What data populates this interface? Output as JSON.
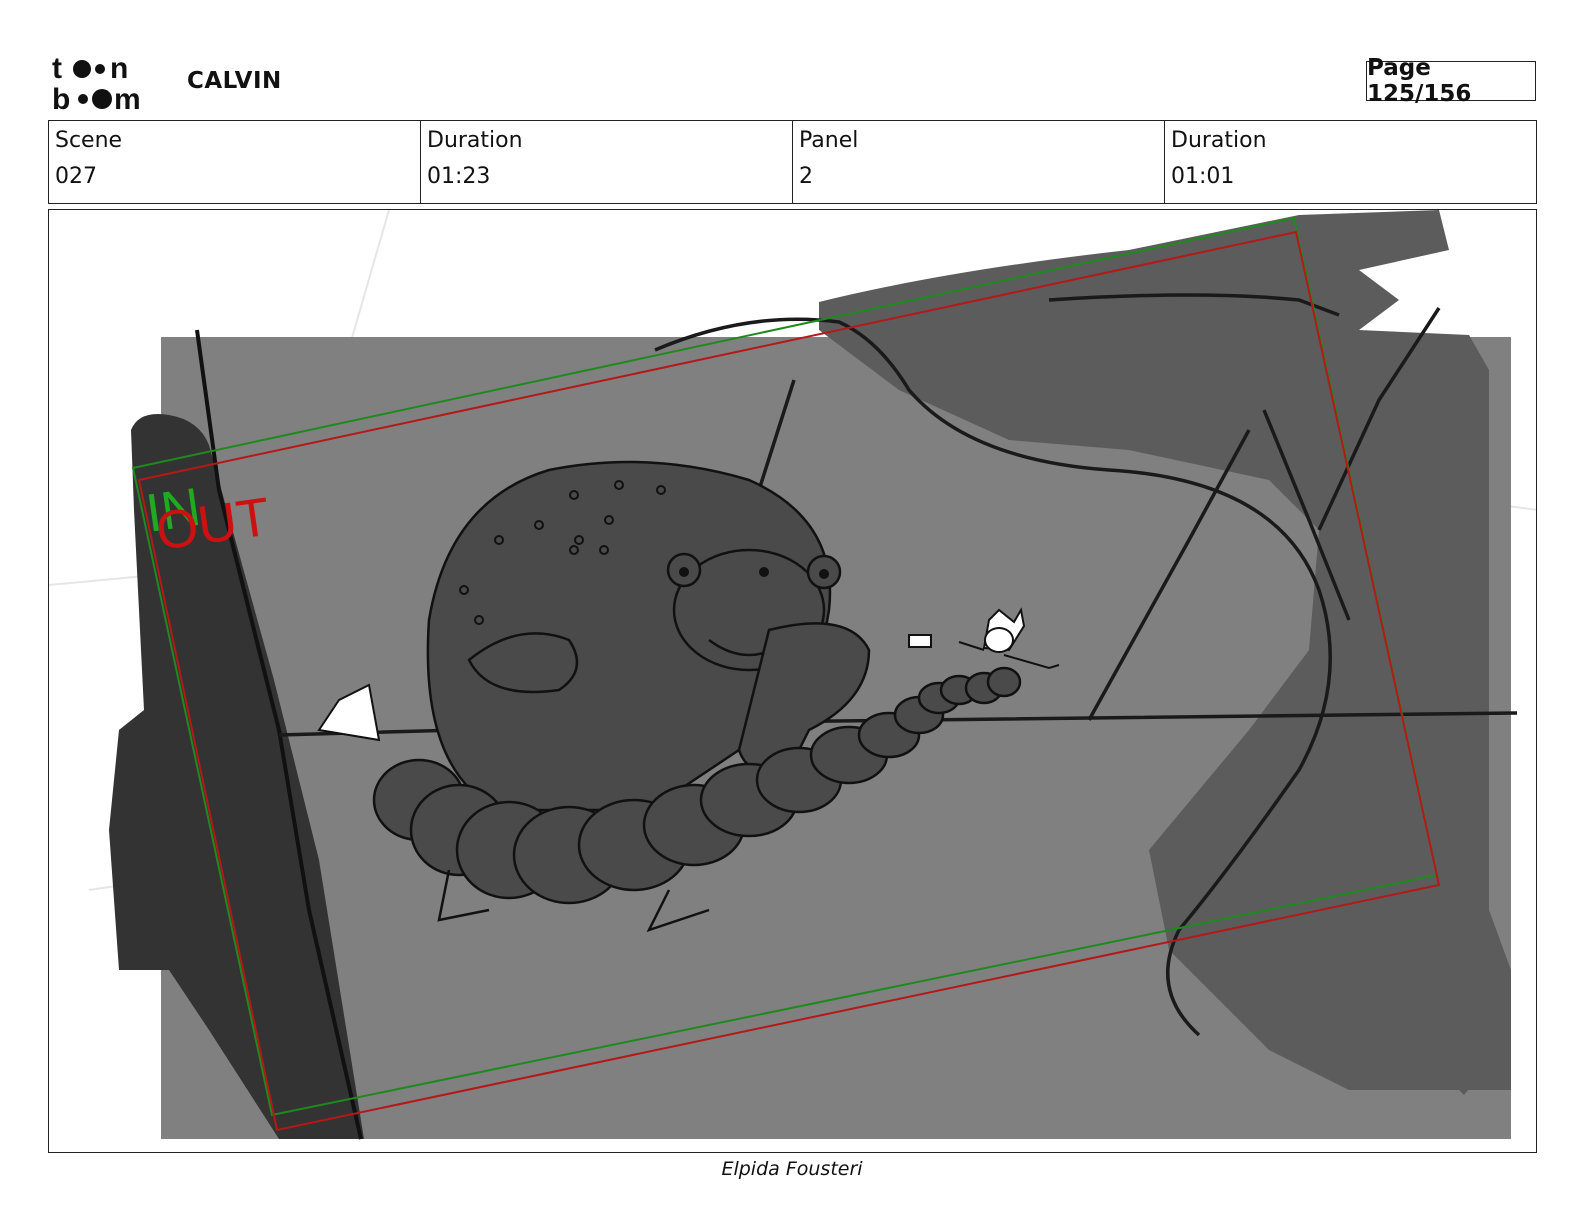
{
  "header": {
    "project_title": "CALVIN",
    "page_label": "Page 125/156",
    "logo_icon": "toon-boom-logo"
  },
  "info": {
    "scene_label": "Scene",
    "scene_value": "027",
    "scene_duration_label": "Duration",
    "scene_duration_value": "01:23",
    "panel_label": "Panel",
    "panel_value": "2",
    "panel_duration_label": "Duration",
    "panel_duration_value": "01:01"
  },
  "panel": {
    "in_label": "IN",
    "out_label": "OUT",
    "in_color": "#1faa1f",
    "out_color": "#cc1111"
  },
  "footer": {
    "artist": "Elpida Fousteri"
  }
}
